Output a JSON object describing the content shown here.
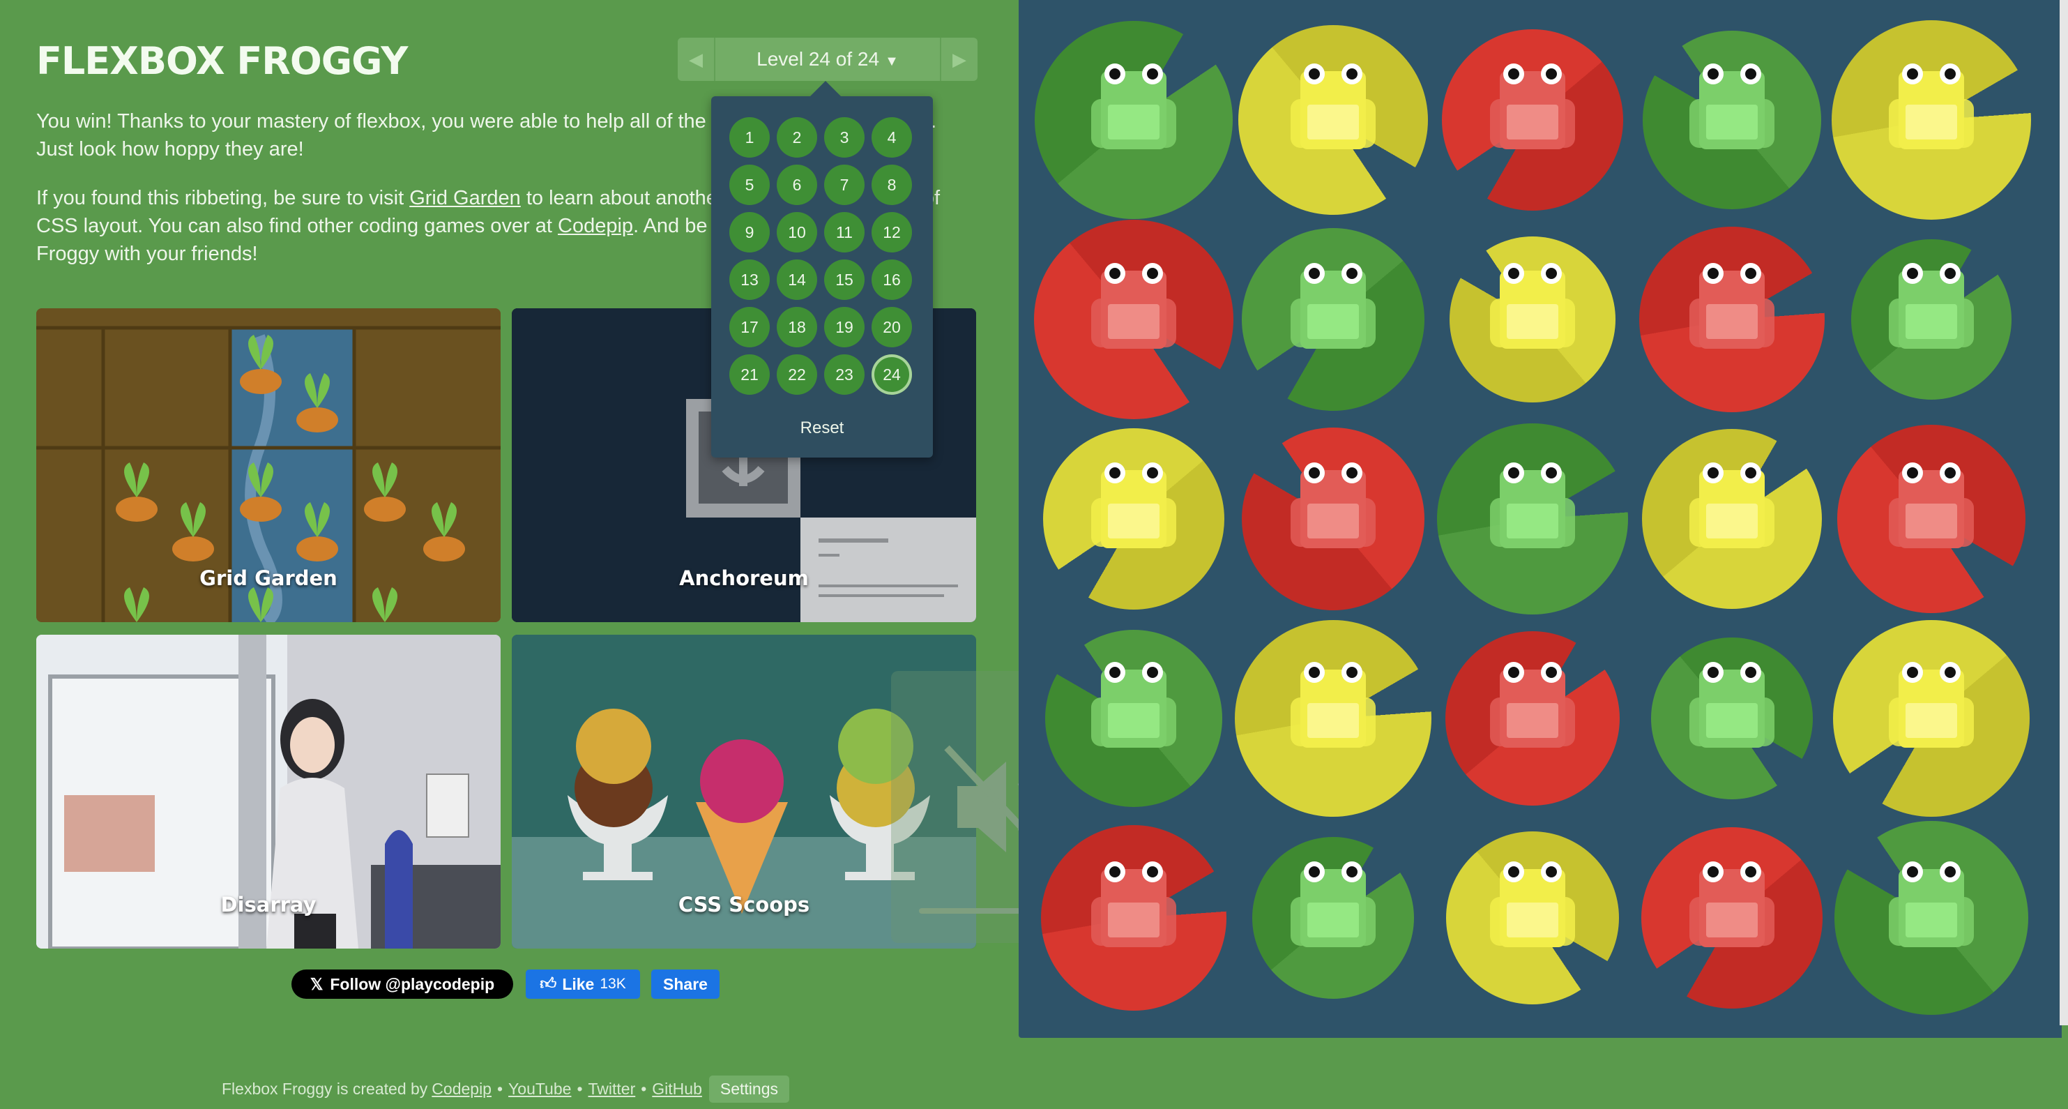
{
  "header": {
    "title": "FLEXBOX FROGGY",
    "level_label": "Level 24 of 24",
    "prev_icon": "triangle-left-icon",
    "next_icon": "triangle-right-icon",
    "caret_icon": "caret-down-icon"
  },
  "intro": {
    "p1": "You win! Thanks to your mastery of flexbox, you were able to help all of the frogs get to their lilypads. Just look how hoppy they are!",
    "p2_a": "If you found this ribbeting, be sure to visit ",
    "p2_link1": "Grid Garden",
    "p2_b": " to learn about another powerful new feature of CSS layout. You can also find other coding games over at ",
    "p2_link2": "Codepip",
    "p2_c": ". And be sure to share Flexbox Froggy with your friends!"
  },
  "cards": {
    "grid_garden": "Grid Garden",
    "anchoreum": "Anchoreum",
    "disarray": "Disarray",
    "css_scoops": "CSS Scoops"
  },
  "social": {
    "follow": "Follow @playcodepip",
    "like": "Like",
    "like_count": "13K",
    "share": "Share",
    "x_icon": "x-logo-icon",
    "thumb_icon": "thumbs-up-icon"
  },
  "footer": {
    "prefix": "Flexbox Froggy is created by",
    "links": [
      "Codepip",
      "YouTube",
      "Twitter",
      "GitHub"
    ],
    "settings": "Settings"
  },
  "level_menu": {
    "levels": [
      "1",
      "2",
      "3",
      "4",
      "5",
      "6",
      "7",
      "8",
      "9",
      "10",
      "11",
      "12",
      "13",
      "14",
      "15",
      "16",
      "17",
      "18",
      "19",
      "20",
      "21",
      "22",
      "23",
      "24"
    ],
    "current": "24",
    "reset": "Reset"
  },
  "overlay": {
    "icon": "speaker-muted-icon"
  },
  "pond": {
    "colors": {
      "green": "#4f9a3f",
      "yellow": "#d8d53a",
      "red": "#d8372f"
    },
    "rows": [
      [
        "green",
        "yellow",
        "red",
        "green",
        "yellow"
      ],
      [
        "red",
        "green",
        "yellow",
        "red",
        "green"
      ],
      [
        "yellow",
        "red",
        "green",
        "yellow",
        "red"
      ],
      [
        "green",
        "yellow",
        "red",
        "green",
        "yellow"
      ],
      [
        "red",
        "green",
        "yellow",
        "red",
        "green"
      ]
    ]
  }
}
